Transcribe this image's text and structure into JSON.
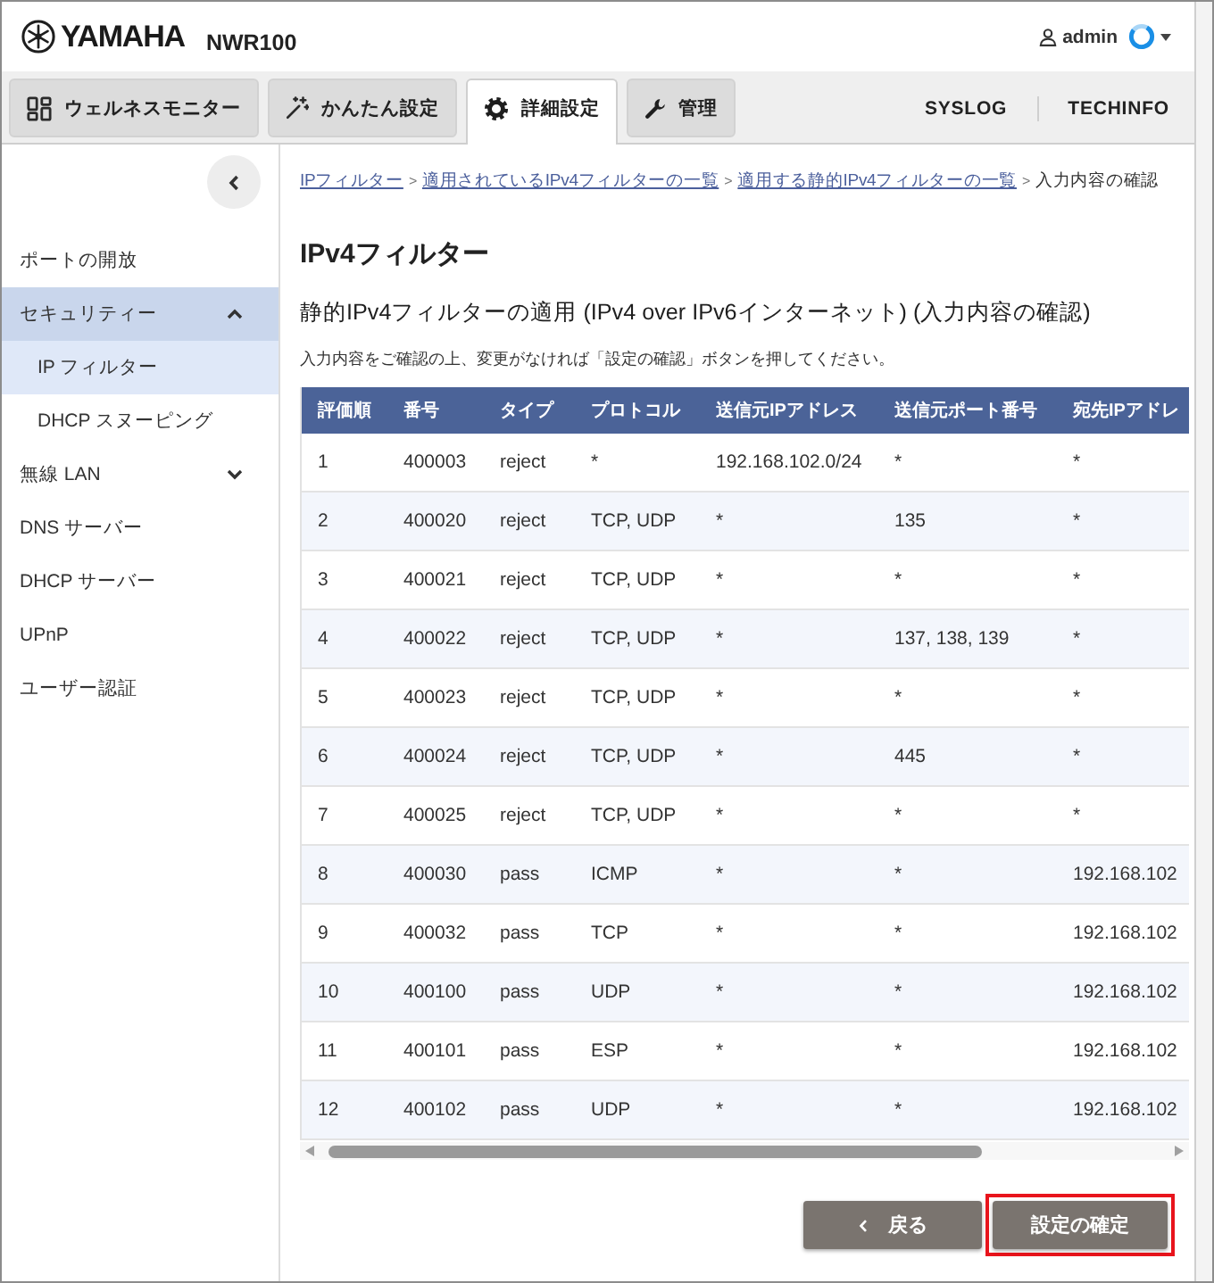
{
  "header": {
    "brand": "YAMAHA",
    "model": "NWR100",
    "user": "admin"
  },
  "tabs": [
    {
      "label": "ウェルネスモニター",
      "selected": false
    },
    {
      "label": "かんたん設定",
      "selected": false
    },
    {
      "label": "詳細設定",
      "selected": true
    },
    {
      "label": "管理",
      "selected": false
    }
  ],
  "top_links": [
    "SYSLOG",
    "TECHINFO"
  ],
  "sidebar": {
    "items": [
      {
        "label": "ポートの開放",
        "kind": "link",
        "selected": false
      },
      {
        "label": "セキュリティー",
        "kind": "group",
        "selected": true,
        "expanded": true,
        "children": [
          {
            "label": "IP フィルター",
            "kind": "link",
            "selected": true
          },
          {
            "label": "DHCP スヌーピング",
            "kind": "link",
            "selected": false
          }
        ]
      },
      {
        "label": "無線 LAN",
        "kind": "group",
        "selected": false,
        "expanded": false
      },
      {
        "label": "DNS サーバー",
        "kind": "link",
        "selected": false
      },
      {
        "label": "DHCP サーバー",
        "kind": "link",
        "selected": false
      },
      {
        "label": "UPnP",
        "kind": "link",
        "selected": false
      },
      {
        "label": "ユーザー認証",
        "kind": "link",
        "selected": false
      }
    ]
  },
  "breadcrumb": {
    "separator": ">",
    "items": [
      {
        "label": "IPフィルター",
        "kind": "link"
      },
      {
        "label": "適用されているIPv4フィルターの一覧",
        "kind": "link"
      },
      {
        "label": "適用する静的IPv4フィルターの一覧",
        "kind": "link"
      },
      {
        "label": "入力内容の確認",
        "kind": "current"
      }
    ]
  },
  "page": {
    "title": "IPv4フィルター",
    "subtitle": "静的IPv4フィルターの適用 (IPv4 over IPv6インターネット) (入力内容の確認)",
    "instruction": "入力内容をご確認の上、変更がなければ「設定の確認」ボタンを押してください。"
  },
  "table": {
    "columns": [
      "評価順",
      "番号",
      "タイプ",
      "プロトコル",
      "送信元IPアドレス",
      "送信元ポート番号",
      "宛先IPアドレ"
    ],
    "rows": [
      [
        "1",
        "400003",
        "reject",
        "*",
        "192.168.102.0/24",
        "*",
        "*"
      ],
      [
        "2",
        "400020",
        "reject",
        "TCP, UDP",
        "*",
        "135",
        "*"
      ],
      [
        "3",
        "400021",
        "reject",
        "TCP, UDP",
        "*",
        "*",
        "*"
      ],
      [
        "4",
        "400022",
        "reject",
        "TCP, UDP",
        "*",
        "137, 138, 139",
        "*"
      ],
      [
        "5",
        "400023",
        "reject",
        "TCP, UDP",
        "*",
        "*",
        "*"
      ],
      [
        "6",
        "400024",
        "reject",
        "TCP, UDP",
        "*",
        "445",
        "*"
      ],
      [
        "7",
        "400025",
        "reject",
        "TCP, UDP",
        "*",
        "*",
        "*"
      ],
      [
        "8",
        "400030",
        "pass",
        "ICMP",
        "*",
        "*",
        "192.168.102"
      ],
      [
        "9",
        "400032",
        "pass",
        "TCP",
        "*",
        "*",
        "192.168.102"
      ],
      [
        "10",
        "400100",
        "pass",
        "UDP",
        "*",
        "*",
        "192.168.102"
      ],
      [
        "11",
        "400101",
        "pass",
        "ESP",
        "*",
        "*",
        "192.168.102"
      ],
      [
        "12",
        "400102",
        "pass",
        "UDP",
        "*",
        "*",
        "192.168.102"
      ]
    ]
  },
  "buttons": [
    {
      "label": "戻る",
      "kind": "back",
      "highlighted": false
    },
    {
      "label": "設定の確定",
      "kind": "submit",
      "highlighted": true
    }
  ]
}
